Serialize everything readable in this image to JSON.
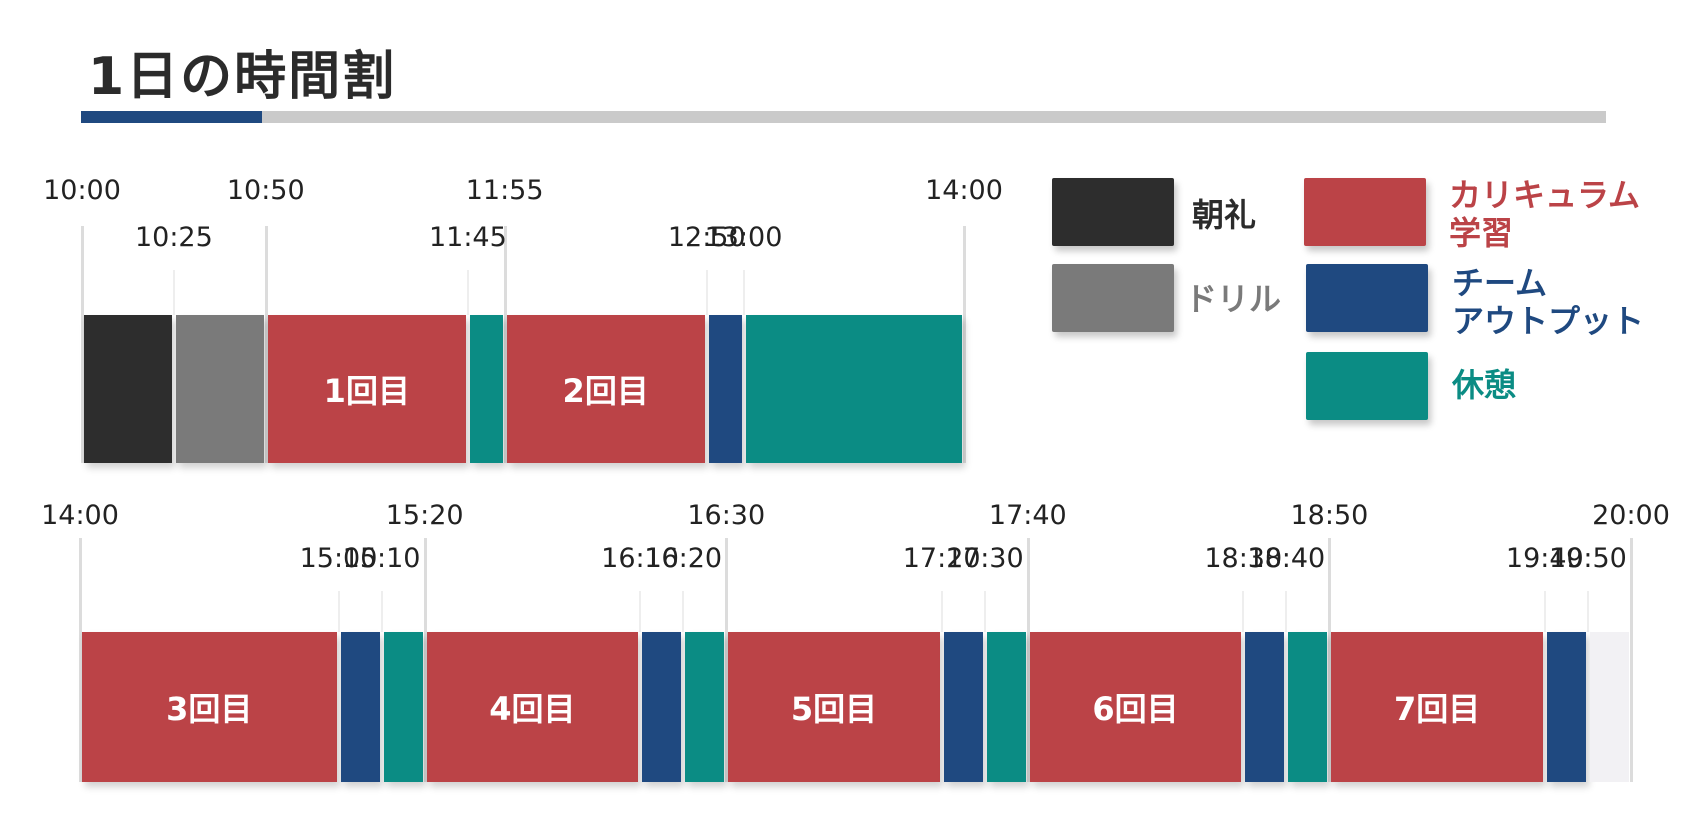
{
  "title": "1日の時間割",
  "colors": {
    "choreii": "#2d2d2d",
    "drill": "#7a7a7a",
    "curriculum": "#bb4347",
    "team": "#1f4980",
    "rest": "#0b8c84",
    "accent": "#1f4980",
    "track": "#cacaca"
  },
  "legend": [
    {
      "key": "choreii",
      "label": "朝礼",
      "text_color": "#2b2b2b"
    },
    {
      "key": "drill",
      "label": "ドリル",
      "text_color": "#7a7a7a"
    },
    {
      "key": "curriculum",
      "label": "カリキュラム\n学習",
      "text_color": "#bb4347"
    },
    {
      "key": "team",
      "label": "チーム\nアウトプット",
      "text_color": "#1f4980"
    },
    {
      "key": "rest",
      "label": "休憩",
      "text_color": "#0b8c84"
    }
  ],
  "rows": [
    {
      "start": "10:00",
      "end": "14:00",
      "major_ticks": [
        "10:00",
        "10:50",
        "11:55",
        "14:00"
      ],
      "minor_ticks": [
        "10:25",
        "11:45",
        "12:50",
        "13:00"
      ],
      "blocks": [
        {
          "start": "10:00",
          "end": "10:25",
          "type": "choreii",
          "label": ""
        },
        {
          "start": "10:25",
          "end": "10:50",
          "type": "drill",
          "label": ""
        },
        {
          "start": "10:50",
          "end": "11:45",
          "type": "curriculum",
          "label": "1回目"
        },
        {
          "start": "11:45",
          "end": "11:55",
          "type": "rest",
          "label": ""
        },
        {
          "start": "11:55",
          "end": "12:50",
          "type": "curriculum",
          "label": "2回目"
        },
        {
          "start": "12:50",
          "end": "13:00",
          "type": "team",
          "label": ""
        },
        {
          "start": "13:00",
          "end": "14:00",
          "type": "rest",
          "label": ""
        }
      ]
    },
    {
      "start": "14:00",
      "end": "20:00",
      "major_ticks": [
        "14:00",
        "15:20",
        "16:30",
        "17:40",
        "18:50",
        "20:00"
      ],
      "minor_ticks": [
        "15:00",
        "15:10",
        "16:10",
        "16:20",
        "17:20",
        "17:30",
        "18:30",
        "18:40",
        "19:40",
        "19:50"
      ],
      "blocks": [
        {
          "start": "14:00",
          "end": "15:00",
          "type": "curriculum",
          "label": "3回目"
        },
        {
          "start": "15:00",
          "end": "15:10",
          "type": "team",
          "label": ""
        },
        {
          "start": "15:10",
          "end": "15:20",
          "type": "rest",
          "label": ""
        },
        {
          "start": "15:20",
          "end": "16:10",
          "type": "curriculum",
          "label": "4回目"
        },
        {
          "start": "16:10",
          "end": "16:20",
          "type": "team",
          "label": ""
        },
        {
          "start": "16:20",
          "end": "16:30",
          "type": "rest",
          "label": ""
        },
        {
          "start": "16:30",
          "end": "17:20",
          "type": "curriculum",
          "label": "5回目"
        },
        {
          "start": "17:20",
          "end": "17:30",
          "type": "team",
          "label": ""
        },
        {
          "start": "17:30",
          "end": "17:40",
          "type": "rest",
          "label": ""
        },
        {
          "start": "17:40",
          "end": "18:30",
          "type": "curriculum",
          "label": "6回目"
        },
        {
          "start": "18:30",
          "end": "18:40",
          "type": "team",
          "label": ""
        },
        {
          "start": "18:40",
          "end": "18:50",
          "type": "rest",
          "label": ""
        },
        {
          "start": "18:50",
          "end": "19:40",
          "type": "curriculum",
          "label": "7回目"
        },
        {
          "start": "19:40",
          "end": "19:50",
          "type": "team",
          "label": ""
        },
        {
          "start": "19:50",
          "end": "20:00",
          "type": "empty",
          "label": ""
        }
      ]
    }
  ]
}
